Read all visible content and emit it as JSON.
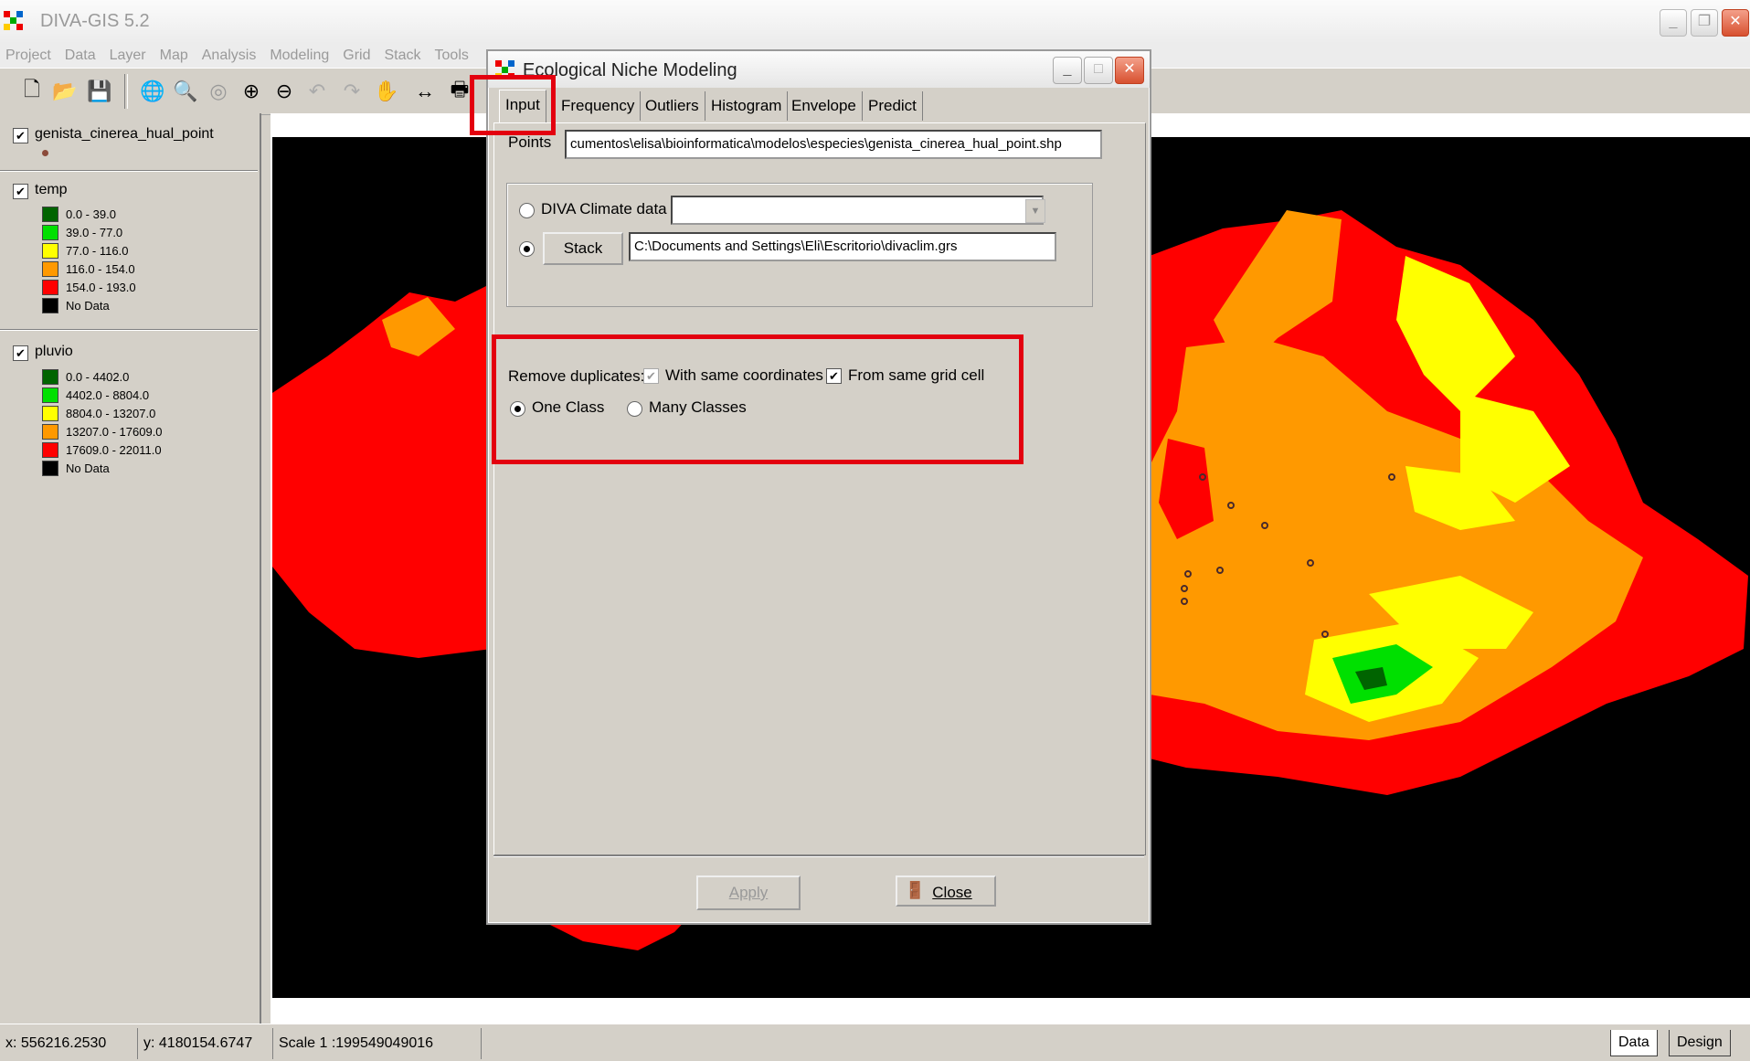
{
  "app": {
    "title": "DIVA-GIS 5.2"
  },
  "menu": [
    "Project",
    "Data",
    "Layer",
    "Map",
    "Analysis",
    "Modeling",
    "Grid",
    "Stack",
    "Tools"
  ],
  "toolbar_icons": [
    "new-file-icon",
    "open-folder-icon",
    "save-icon",
    "globe-icon",
    "zoom-extent-icon",
    "zoom-layer-icon",
    "zoom-in-icon",
    "zoom-out-icon",
    "undo-icon",
    "redo-icon",
    "pan-hand-icon",
    "horizontal-arrows-icon",
    "print-icon"
  ],
  "legend": {
    "layers": [
      {
        "name": "genista_cinerea_hual_point",
        "checked": true,
        "point_color": "#8b4a3a"
      },
      {
        "name": "temp",
        "checked": true,
        "classes": [
          {
            "label": "0.0 - 39.0",
            "color": "#006400"
          },
          {
            "label": "39.0 - 77.0",
            "color": "#00e000"
          },
          {
            "label": "77.0 - 116.0",
            "color": "#ffff00"
          },
          {
            "label": "116.0 - 154.0",
            "color": "#ff9900"
          },
          {
            "label": "154.0 - 193.0",
            "color": "#ff0000"
          },
          {
            "label": "No Data",
            "color": "#000000"
          }
        ]
      },
      {
        "name": "pluvio",
        "checked": true,
        "classes": [
          {
            "label": "0.0 - 4402.0",
            "color": "#006400"
          },
          {
            "label": "4402.0 - 8804.0",
            "color": "#00e000"
          },
          {
            "label": "8804.0 - 13207.0",
            "color": "#ffff00"
          },
          {
            "label": "13207.0 - 17609.0",
            "color": "#ff9900"
          },
          {
            "label": "17609.0 - 22011.0",
            "color": "#ff0000"
          },
          {
            "label": "No Data",
            "color": "#000000"
          }
        ]
      }
    ]
  },
  "dialog": {
    "title": "Ecological Niche Modeling",
    "tabs": [
      "Input",
      "Frequency",
      "Outliers",
      "Histogram",
      "Envelope",
      "Predict"
    ],
    "active_tab": "Input",
    "points_label": "Points",
    "points_value": "cumentos\\elisa\\bioinformatica\\modelos\\especies\\genista_cinerea_hual_point.shp",
    "diva_climate_label": "DIVA Climate data",
    "diva_climate_value": "",
    "stack_button": "Stack",
    "stack_value": "C:\\Documents and Settings\\Eli\\Escritorio\\divaclim.grs",
    "remove_duplicates_label": "Remove duplicates:",
    "same_coords_label": "With same coordinates",
    "same_coords_checked": true,
    "same_grid_label": "From same grid cell",
    "same_grid_checked": true,
    "one_class_label": "One Class",
    "many_classes_label": "Many Classes",
    "class_mode": "One Class",
    "apply_button": "Apply",
    "close_button": "Close"
  },
  "status": {
    "x": "x: 556216.2530",
    "y": "y: 4180154.6747",
    "scale": "Scale 1 :199549049016",
    "tab_data": "Data",
    "tab_design": "Design"
  },
  "colors": {
    "highlight": "#e3000f",
    "map_red": "#ff0000",
    "map_orange": "#ff9900",
    "map_yellow": "#ffff00",
    "map_green": "#00e000"
  }
}
